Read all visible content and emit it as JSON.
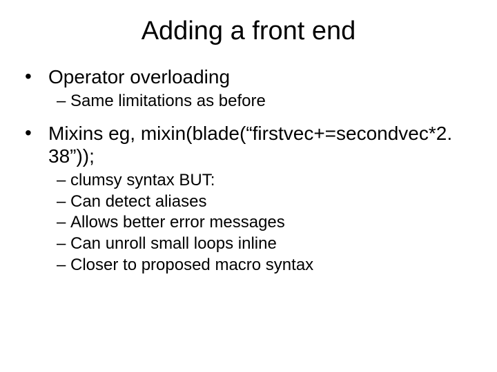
{
  "slide": {
    "title": "Adding a front end",
    "items": [
      {
        "text": "Operator overloading",
        "sub": [
          "Same limitations as before"
        ]
      },
      {
        "text": "Mixins  eg, mixin(blade(“firstvec+=secondvec*2. 38”));",
        "sub": [
          "clumsy syntax BUT:",
          "Can detect aliases",
          "Allows better error messages",
          "Can unroll small loops inline",
          "Closer to proposed macro syntax"
        ]
      }
    ]
  }
}
